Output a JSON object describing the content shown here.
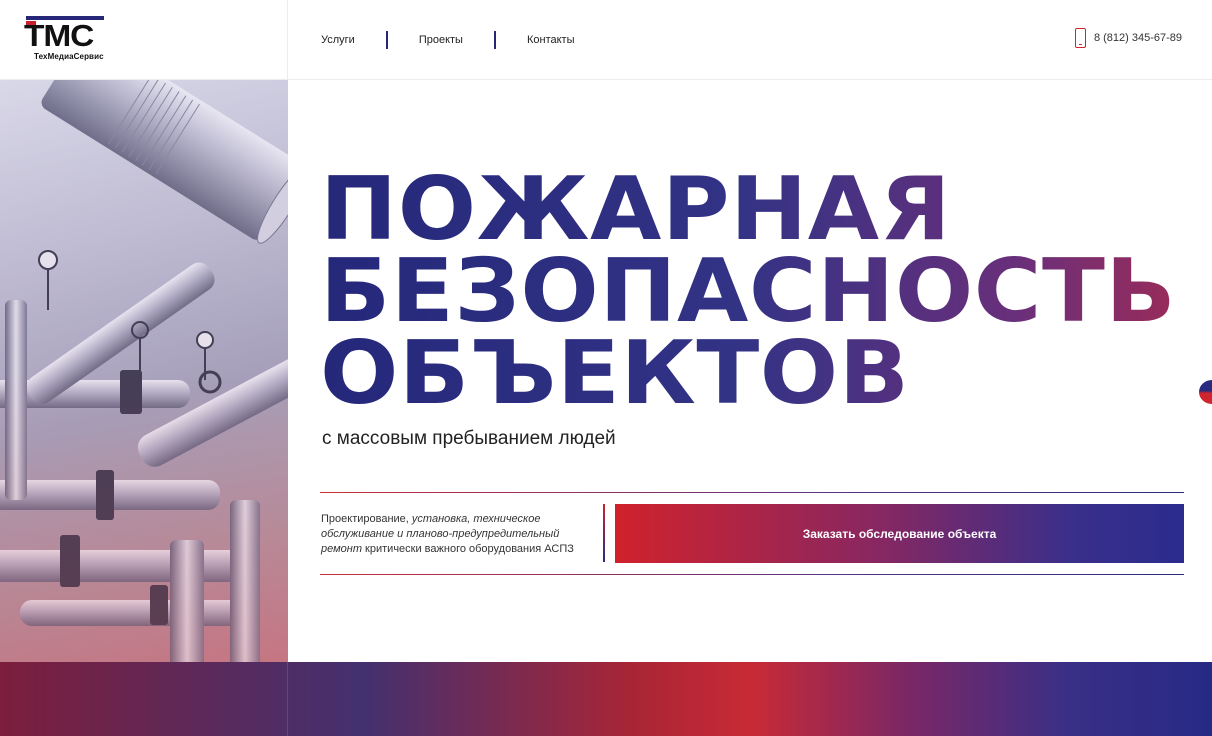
{
  "logo": {
    "mark": "ТМС",
    "name": "ТехМедиаСервис"
  },
  "nav": {
    "items": [
      {
        "label": "Услуги"
      },
      {
        "label": "Проекты"
      },
      {
        "label": "Контакты"
      }
    ]
  },
  "contact": {
    "phone": "8 (812) 345-67-89"
  },
  "hero": {
    "title_lines": [
      "ПОЖАРНАЯ",
      "БЕЗОПАСНОСТЬ",
      "ОБЪЕКТОВ"
    ],
    "subtitle": "с массовым пребыванием людей",
    "description": {
      "part1": "Проектирование, ",
      "part2_italic": "установка, техническое обслуживание и планово-предупредительный ремонт",
      "part3": " критически важного оборудования АСПЗ"
    },
    "cta_label": "Заказать обследование объекта"
  },
  "colors": {
    "navy": "#27277a",
    "red": "#d0242e",
    "violet": "#6a2f7a"
  },
  "icons": {
    "phone": "phone-icon"
  }
}
